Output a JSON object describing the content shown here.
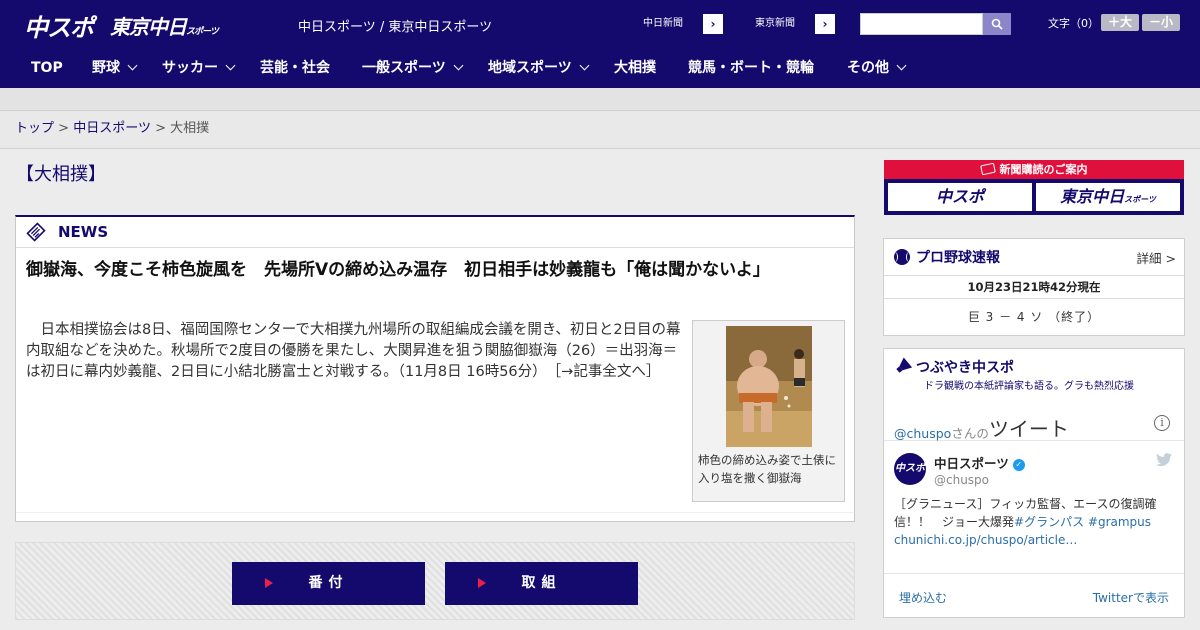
{
  "header": {
    "logo_chuspo": "中スポ",
    "logo_tokyo": "東京中日",
    "logo_tokyo_small": "スポーツ",
    "site_name": "中日スポーツ / 東京中日スポーツ",
    "paper_links": [
      "中日新聞",
      "東京新聞"
    ],
    "search": {
      "value": "",
      "placeholder": ""
    },
    "font_size_label": "文字（0）",
    "font_plus": "＋大",
    "font_minus": "－小"
  },
  "nav": {
    "items": [
      {
        "label": "TOP",
        "dropdown": false
      },
      {
        "label": "野球",
        "dropdown": true
      },
      {
        "label": "サッカー",
        "dropdown": true
      },
      {
        "label": "芸能・社会",
        "dropdown": false
      },
      {
        "label": "一般スポーツ",
        "dropdown": true
      },
      {
        "label": "地域スポーツ",
        "dropdown": true
      },
      {
        "label": "大相撲",
        "dropdown": false
      },
      {
        "label": "競馬・ボート・競輪",
        "dropdown": false
      },
      {
        "label": "その他",
        "dropdown": true
      }
    ]
  },
  "breadcrumb": {
    "top": "トップ",
    "sep": ">",
    "chunichi": "中日スポーツ",
    "current": "大相撲"
  },
  "page_title": "【大相撲】",
  "news": {
    "label": "NEWS",
    "headline": "御嶽海、今度こそ柿色旋風を　先場所Vの締め込み温存　初日相手は妙義龍も「俺は聞かないよ」",
    "body": "日本相撲協会は8日、福岡国際センターで大相撲九州場所の取組編成会議を開き、初日と2日目の幕内取組などを決めた。秋場所で2度目の優勝を果たし、大関昇進を狙う関脇御嶽海（26）＝出羽海＝は初日に幕内妙義龍、2日目に小結北勝富士と対戦する。（11月8日 16時56分）",
    "more_link": "［→記事全文へ］",
    "caption": "柿色の締め込み姿で土俵に入り塩を撒く御嶽海"
  },
  "buttons": {
    "banzuke": "番付",
    "torikumi": "取組"
  },
  "sidebar": {
    "subscribe": {
      "title": "新聞購読のご案内",
      "logo_chuspo": "中スポ",
      "logo_tokyo": "東京中日",
      "logo_tokyo_small": "スポーツ"
    },
    "baseball": {
      "title": "プロ野球速報",
      "detail": "詳細 >",
      "time": "10月23日21時42分現在",
      "score": "巨 3 － 4 ソ （終了）"
    },
    "twitter": {
      "title": "つぶやき中スポ",
      "subtitle": "ドラ観戦の本紙評論家も語る。グラも熱烈応援",
      "at_handle": "@chuspo",
      "san_no": "さんの",
      "tweet_word": "ツイート",
      "avatar_text": "中スポ",
      "account_name": "中日スポーツ",
      "account_handle": "@chuspo",
      "tweet_text": "［グラニュース］フィッカ監督、エースの復調確信！！　ジョー大爆発",
      "tag1": "#グランパス",
      "tag2": "#grampus",
      "tweet_link": "chunichi.co.jp/chuspo/article…",
      "embed": "埋め込む",
      "view_on": "Twitterで表示"
    }
  },
  "colors": {
    "brand_navy": "#140a6e",
    "accent_red": "#e0103c",
    "link_blue": "#2a6ea8"
  }
}
